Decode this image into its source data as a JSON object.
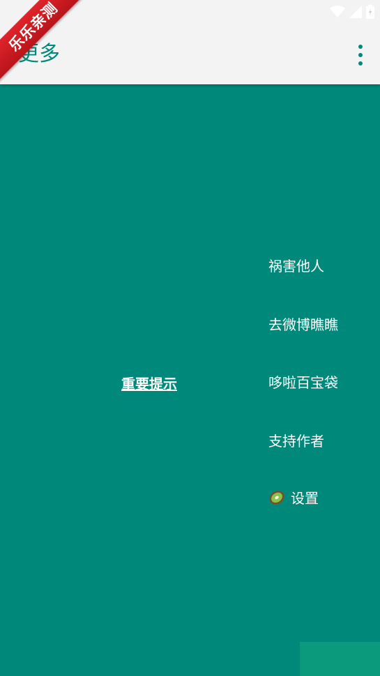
{
  "appbar": {
    "title": "更多",
    "ribbon_text": "乐乐亲测"
  },
  "main": {
    "notice_link": "重要提示",
    "menu": [
      {
        "label": "祸害他人"
      },
      {
        "label": "去微博瞧瞧"
      },
      {
        "label": "哆啦百宝袋"
      },
      {
        "label": "支持作者"
      },
      {
        "label": "设置",
        "icon": "kiwi-icon"
      }
    ]
  },
  "colors": {
    "accent": "#00897B",
    "appbar_bg": "#F3F3F3",
    "ribbon": "#D71E26"
  }
}
